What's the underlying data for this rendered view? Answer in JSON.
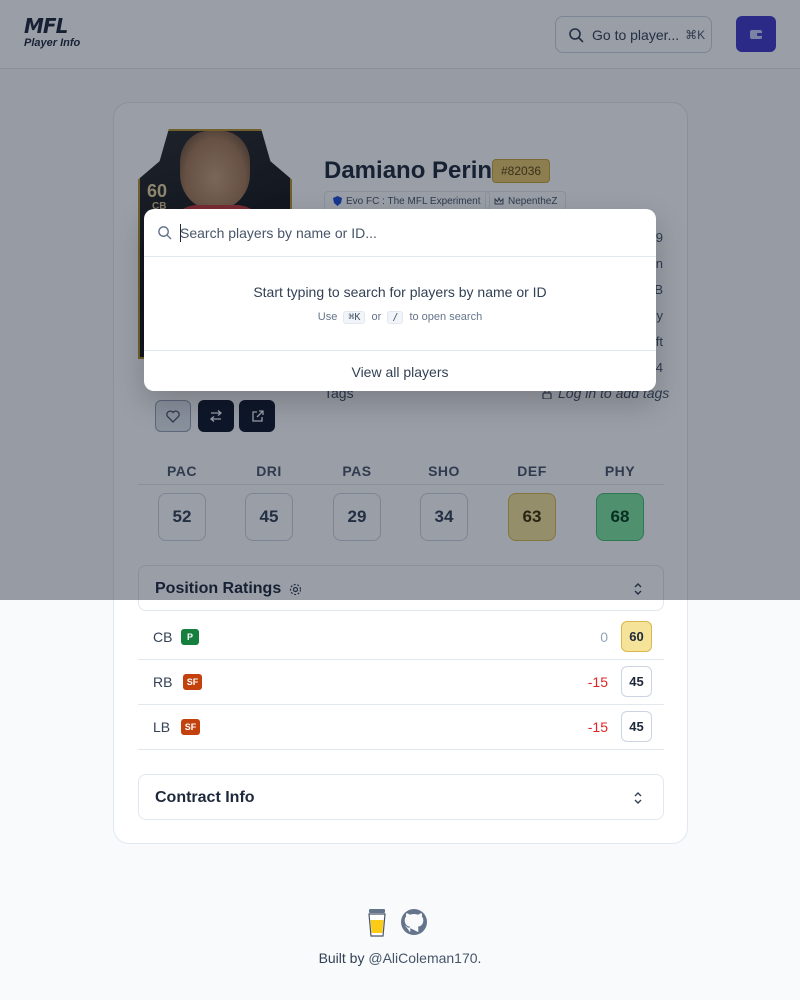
{
  "header": {
    "logo_mark": "MFL",
    "logo_subtitle": "Player Info",
    "search_label": "Go to player...",
    "search_shortcut": "⌘K",
    "colors": {
      "accent": "#4338ca"
    }
  },
  "player": {
    "name": "Damiano Perini",
    "id_badge": "#82036",
    "overall": "60",
    "position": "CB",
    "club": "Evo FC : The MFL Experiment",
    "owner": "NepentheZ",
    "info_values": [
      "9",
      "n",
      "B",
      "y",
      "ft",
      "4"
    ],
    "tags_label": "Tags",
    "tags_action": "Log in to add tags"
  },
  "stats": {
    "headers": [
      "PAC",
      "DRI",
      "PAS",
      "SHO",
      "DEF",
      "PHY"
    ],
    "values": [
      "52",
      "45",
      "29",
      "34",
      "63",
      "68"
    ]
  },
  "position_ratings": {
    "title": "Position Ratings",
    "rows": [
      {
        "pos": "CB",
        "badge": "P",
        "diff": "0",
        "score": "60"
      },
      {
        "pos": "RB",
        "badge": "SF",
        "diff": "-15",
        "score": "45"
      },
      {
        "pos": "LB",
        "badge": "SF",
        "diff": "-15",
        "score": "45"
      }
    ]
  },
  "contract": {
    "title": "Contract Info"
  },
  "footer": {
    "built_by": "Built by ",
    "author": "@AliColeman170",
    "period": "."
  },
  "search_modal": {
    "placeholder": "Search players by name or ID...",
    "message": "Start typing to search for players by name or ID",
    "hint_use": "Use",
    "hint_key1": "⌘K",
    "hint_or": "or",
    "hint_key2": "/",
    "hint_tail": "to open search",
    "view_all": "View all players"
  }
}
